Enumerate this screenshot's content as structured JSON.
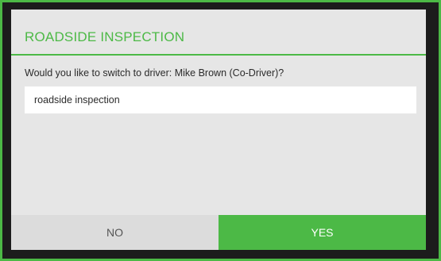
{
  "colors": {
    "accent": "#4cb946",
    "frame": "#1c1c1c",
    "dialog_background": "#e6e6e6",
    "field_background": "#ffffff",
    "no_button_background": "#dcdcdc"
  },
  "dialog": {
    "title": "ROADSIDE INSPECTION",
    "prompt": "Would you like to switch to driver: Mike Brown (Co-Driver)?",
    "reason_value": "roadside inspection",
    "buttons": {
      "no_label": "NO",
      "yes_label": "YES"
    }
  }
}
